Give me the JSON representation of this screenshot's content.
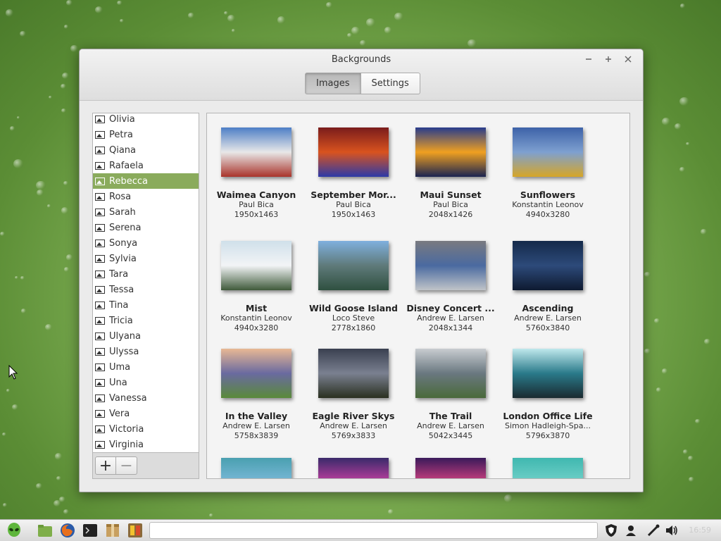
{
  "window": {
    "title": "Backgrounds"
  },
  "tabs": [
    {
      "label": "Images",
      "active": true
    },
    {
      "label": "Settings",
      "active": false
    }
  ],
  "sidebar": {
    "items": [
      "Olivia",
      "Petra",
      "Qiana",
      "Rafaela",
      "Rebecca",
      "Rosa",
      "Sarah",
      "Serena",
      "Sonya",
      "Sylvia",
      "Tara",
      "Tessa",
      "Tina",
      "Tricia",
      "Ulyana",
      "Ulyssa",
      "Uma",
      "Una",
      "Vanessa",
      "Vera",
      "Victoria",
      "Virginia"
    ],
    "selected": "Rebecca",
    "add_label": "+",
    "remove_label": "−"
  },
  "images": [
    {
      "name": "Waimea Canyon",
      "author": "Paul Bica",
      "size": "1950x1463",
      "colors": [
        "#4d7fc6",
        "#e8e8e8",
        "#a9342b"
      ]
    },
    {
      "name": "September Mor...",
      "author": "Paul Bica",
      "size": "1950x1463",
      "colors": [
        "#7a1c1c",
        "#d9531e",
        "#2d3aa8"
      ]
    },
    {
      "name": "Maui Sunset",
      "author": "Paul Bica",
      "size": "2048x1426",
      "colors": [
        "#283c8c",
        "#f0a020",
        "#1a2350"
      ]
    },
    {
      "name": "Sunflowers",
      "author": "Konstantin Leonov",
      "size": "4940x3280",
      "colors": [
        "#3d62a8",
        "#7ea0d0",
        "#d6a628"
      ]
    },
    {
      "name": "Mist",
      "author": "Konstantin Leonov",
      "size": "4940x3280",
      "colors": [
        "#cfe0ea",
        "#f2f4f6",
        "#3f5a3a"
      ]
    },
    {
      "name": "Wild Goose Island",
      "author": "Loco Steve",
      "size": "2778x1860",
      "colors": [
        "#7fb0de",
        "#5f7a7a",
        "#2f5040"
      ]
    },
    {
      "name": "Disney Concert ...",
      "author": "Andrew E. Larsen",
      "size": "2048x1344",
      "colors": [
        "#7a7a80",
        "#4a6aa0",
        "#c0c4c8"
      ]
    },
    {
      "name": "Ascending",
      "author": "Andrew E. Larsen",
      "size": "5760x3840",
      "colors": [
        "#142a4a",
        "#2d4a7a",
        "#0e1a30"
      ]
    },
    {
      "name": "In the Valley",
      "author": "Andrew E. Larsen",
      "size": "5758x3839",
      "colors": [
        "#e8b894",
        "#6a6aa0",
        "#5a8a3a"
      ]
    },
    {
      "name": "Eagle River Skys",
      "author": "Andrew E. Larsen",
      "size": "5769x3833",
      "colors": [
        "#3a4050",
        "#7a8090",
        "#2a3020"
      ]
    },
    {
      "name": "The Trail",
      "author": "Andrew E. Larsen",
      "size": "5042x3445",
      "colors": [
        "#c8ccd0",
        "#6a7880",
        "#4a6a3a"
      ]
    },
    {
      "name": "London Office Life",
      "author": "Simon Hadleigh-Spa...",
      "size": "5796x3870",
      "colors": [
        "#bfe8ec",
        "#2a7a8a",
        "#1a2a30"
      ]
    },
    {
      "name": "",
      "author": "",
      "size": "",
      "colors": [
        "#4aa0b0",
        "#7ab8d8",
        "#3a7aa0"
      ]
    },
    {
      "name": "",
      "author": "",
      "size": "",
      "colors": [
        "#3a2a6a",
        "#c040a0",
        "#6a60c0"
      ]
    },
    {
      "name": "",
      "author": "",
      "size": "",
      "colors": [
        "#3a1a5a",
        "#d04080",
        "#a03090"
      ]
    },
    {
      "name": "",
      "author": "",
      "size": "",
      "colors": [
        "#40b8b0",
        "#70d0c8",
        "#3aa0a0"
      ]
    }
  ],
  "panel": {
    "clock": "16:59"
  }
}
